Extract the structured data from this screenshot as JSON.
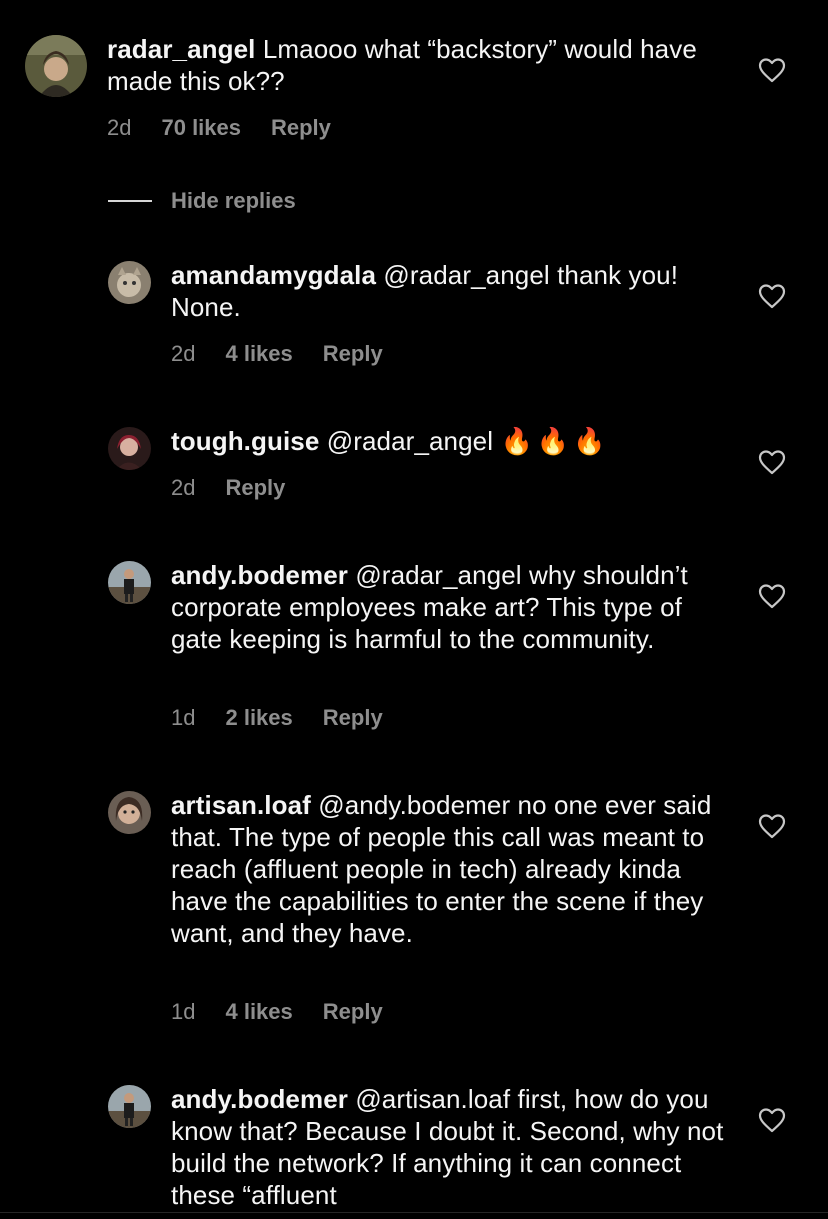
{
  "hide_replies_label": "Hide replies",
  "heart_color": "#c7c7c7",
  "meta_color": "#8e8e8e",
  "comments": [
    {
      "username": "radar_angel",
      "text": "Lmaooo what “backstory” would have made this ok??",
      "time": "2d",
      "likes": "70 likes",
      "reply": "Reply"
    },
    {
      "username": "amandamygdala",
      "text": "@radar_angel thank you! None.",
      "time": "2d",
      "likes": "4 likes",
      "reply": "Reply"
    },
    {
      "username": "tough.guise",
      "text": "@radar_angel",
      "emoji": "🔥🔥🔥",
      "time": "2d",
      "reply": "Reply"
    },
    {
      "username": "andy.bodemer",
      "text": "@radar_angel why shouldn’t corporate employees make art? This type of gate keeping is harmful to the community.",
      "time": "1d",
      "likes": "2 likes",
      "reply": "Reply"
    },
    {
      "username": "artisan.loaf",
      "text": "@andy.bodemer no one ever said that. The type of people this call was meant to reach (affluent people in tech) already kinda have the capabilities to enter the scene if they want, and they have.",
      "time": "1d",
      "likes": "4 likes",
      "reply": "Reply"
    },
    {
      "username": "andy.bodemer",
      "text": "@artisan.loaf first, how do you know that? Because I doubt it. Second, why not build the network? If anything it can connect these “affluent"
    }
  ]
}
